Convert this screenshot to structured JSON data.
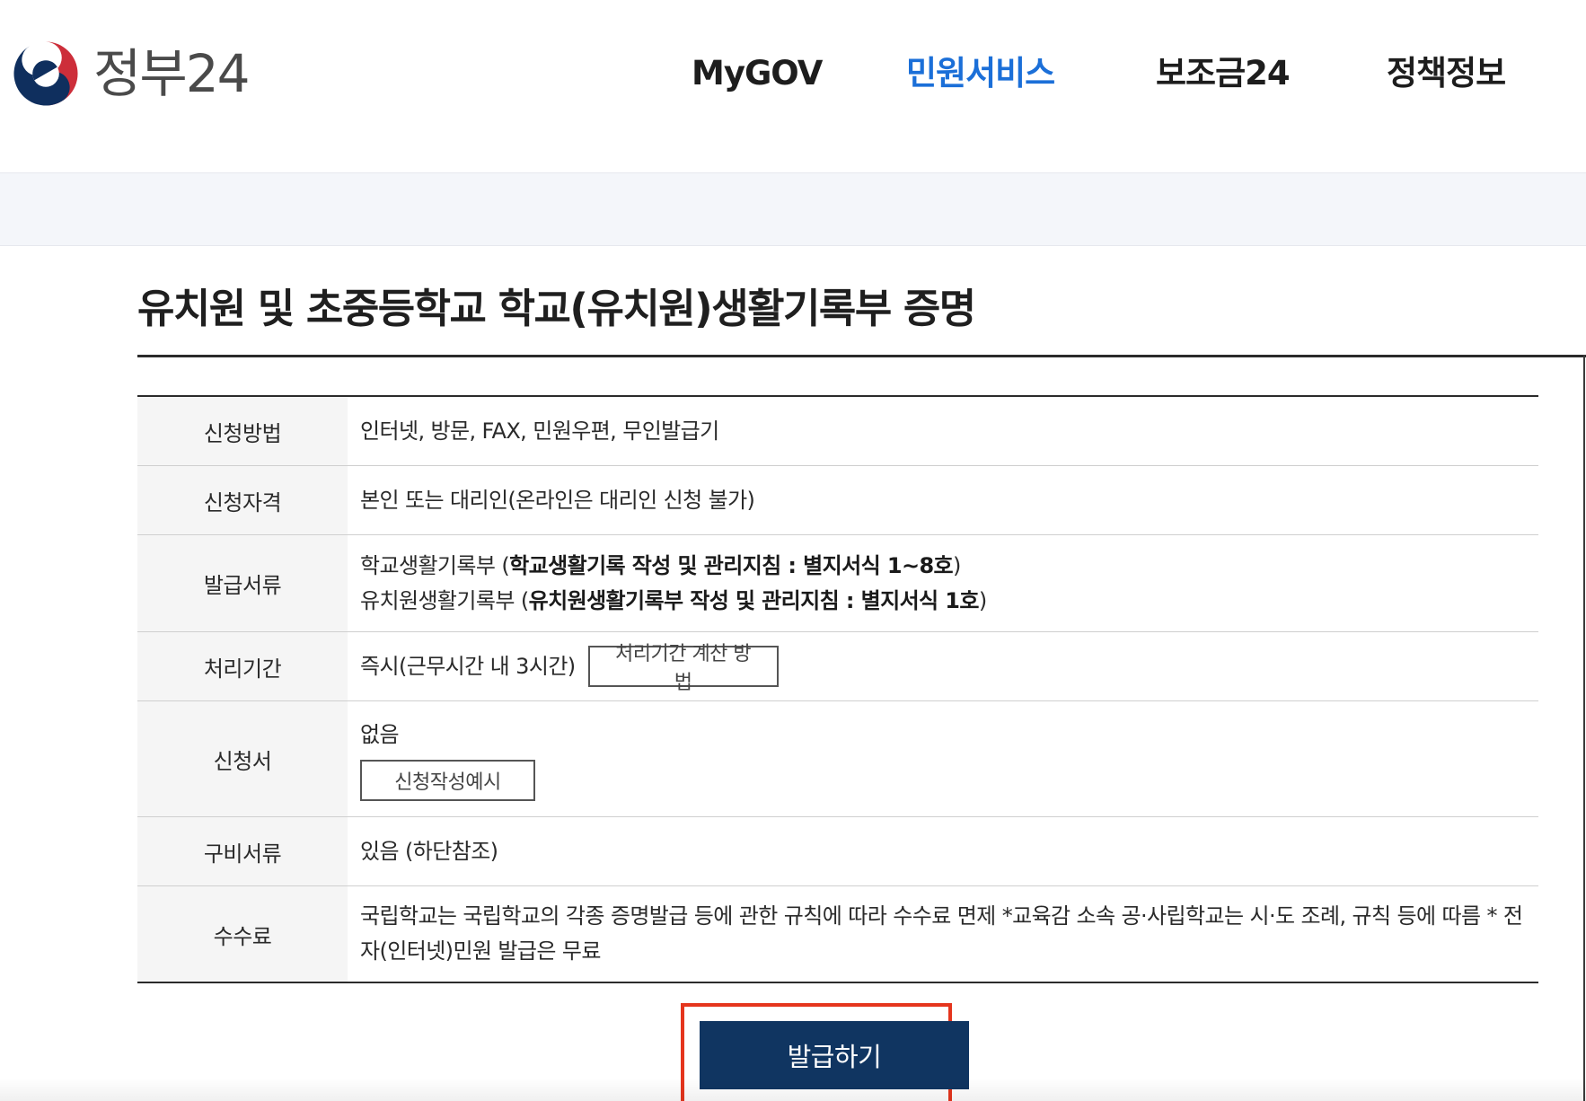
{
  "header": {
    "logo_text": "정부24",
    "nav": [
      {
        "label": "MyGOV",
        "active": false
      },
      {
        "label": "민원서비스",
        "active": true
      },
      {
        "label": "보조금24",
        "active": false
      },
      {
        "label": "정책정보",
        "active": false
      }
    ]
  },
  "page": {
    "title": "유치원 및 초중등학교 학교(유치원)생활기록부 증명"
  },
  "info_table": {
    "method": {
      "label": "신청방법",
      "value": "인터넷, 방문, FAX, 민원우편, 무인발급기"
    },
    "qualification": {
      "label": "신청자격",
      "value": "본인 또는 대리인(온라인은 대리인 신청 불가)"
    },
    "documents": {
      "label": "발급서류",
      "line1_prefix": "학교생활기록부 (",
      "line1_bold": "학교생활기록 작성 및 관리지침 : 별지서식 1~8호",
      "line1_suffix": ")",
      "line2_prefix": "유치원생활기록부 (",
      "line2_bold": "유치원생활기록부 작성 및 관리지침 : 별지서식 1호",
      "line2_suffix": ")"
    },
    "processing": {
      "label": "처리기간",
      "value": "즉시(근무시간 내 3시간)",
      "button_label": "처리기간 계산 방법"
    },
    "application": {
      "label": "신청서",
      "value": "없음",
      "button_label": "신청작성예시"
    },
    "required_docs": {
      "label": "구비서류",
      "value": "있음 (하단참조)"
    },
    "fee": {
      "label": "수수료",
      "value": "국립학교는 국립학교의 각종 증명발급 등에 관한 규칙에 따라 수수료 면제 *교육감 소속 공·사립학교는 시·도 조례, 규칙 등에 따름 * 전자(인터넷)민원 발급은 무료"
    }
  },
  "actions": {
    "issue_label": "발급하기"
  },
  "colors": {
    "nav_active": "#1b6fd8",
    "primary_button": "#103561",
    "highlight_frame": "#e5351d"
  }
}
